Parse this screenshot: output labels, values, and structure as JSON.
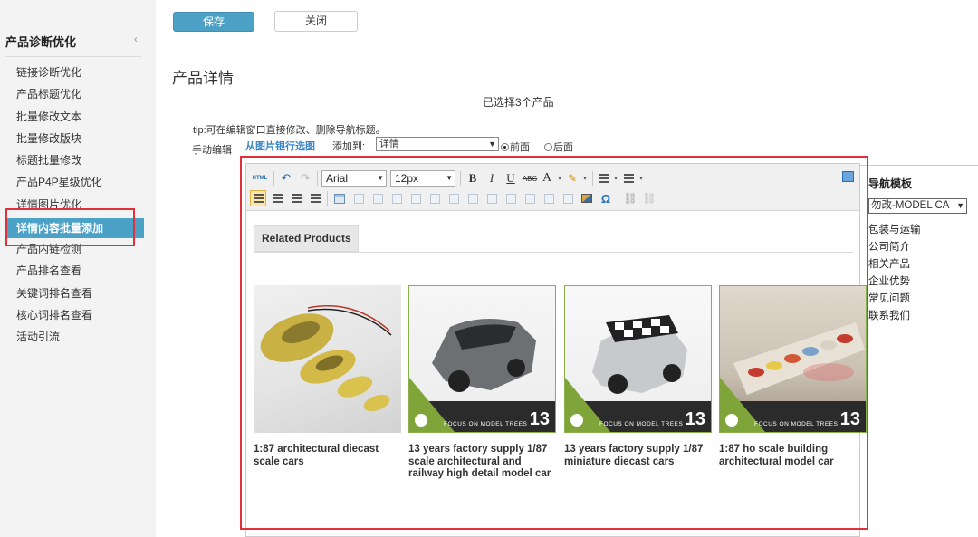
{
  "sidebar": {
    "title": "产品诊断优化",
    "collapse_icon": "‹",
    "items": [
      {
        "label": "链接诊断优化"
      },
      {
        "label": "产品标题优化"
      },
      {
        "label": "批量修改文本"
      },
      {
        "label": "批量修改版块"
      },
      {
        "label": "标题批量修改"
      },
      {
        "label": "产品P4P星级优化"
      },
      {
        "label": "详情图片优化"
      },
      {
        "label": "详情内容批量添加",
        "active": true
      },
      {
        "label": "产品内链检测"
      },
      {
        "label": "产品排名查看"
      },
      {
        "label": "关键词排名查看"
      },
      {
        "label": "核心词排名查看"
      },
      {
        "label": "活动引流"
      }
    ]
  },
  "topbar": {
    "save_label": "保存",
    "close_label": "关闭"
  },
  "page": {
    "title": "产品详情",
    "selected_count": "已选择3个产品",
    "tip": "tip:可在编辑窗口直接修改、删除导航标题。",
    "manual_edit": "手动编辑",
    "image_bank_link": "从图片银行选图",
    "add_to_label": "添加到:",
    "add_to_value": "详情",
    "radio_front": "前面",
    "radio_back": "后面"
  },
  "editor": {
    "font_family": "Arial",
    "font_size": "12px",
    "html_label": "HTML",
    "bold": "B",
    "italic": "I",
    "underline": "U",
    "strike": "ABC",
    "font_color": "A",
    "related_tab": "Related Products",
    "products": [
      {
        "name": "1:87 architectural diecast scale cars"
      },
      {
        "name": "13 years factory supply 1/87 scale architectural and railway high detail model car"
      },
      {
        "name": "13 years factory supply 1/87 miniature diecast cars"
      },
      {
        "name": "1:87 ho scale building architectural model car"
      }
    ],
    "banner_text": "FOCUS ON MODEL TREES",
    "banner_num": "13"
  },
  "nav_template": {
    "title": "导航模板",
    "select_value": "勿改-MODEL CA",
    "items": [
      "包装与运输",
      "公司简介",
      "相关产品",
      "企业优势",
      "常见问题",
      "联系我们"
    ]
  },
  "colors": {
    "accent": "#4ca1c6",
    "highlight": "#e0303a",
    "link": "#3a86c8"
  }
}
